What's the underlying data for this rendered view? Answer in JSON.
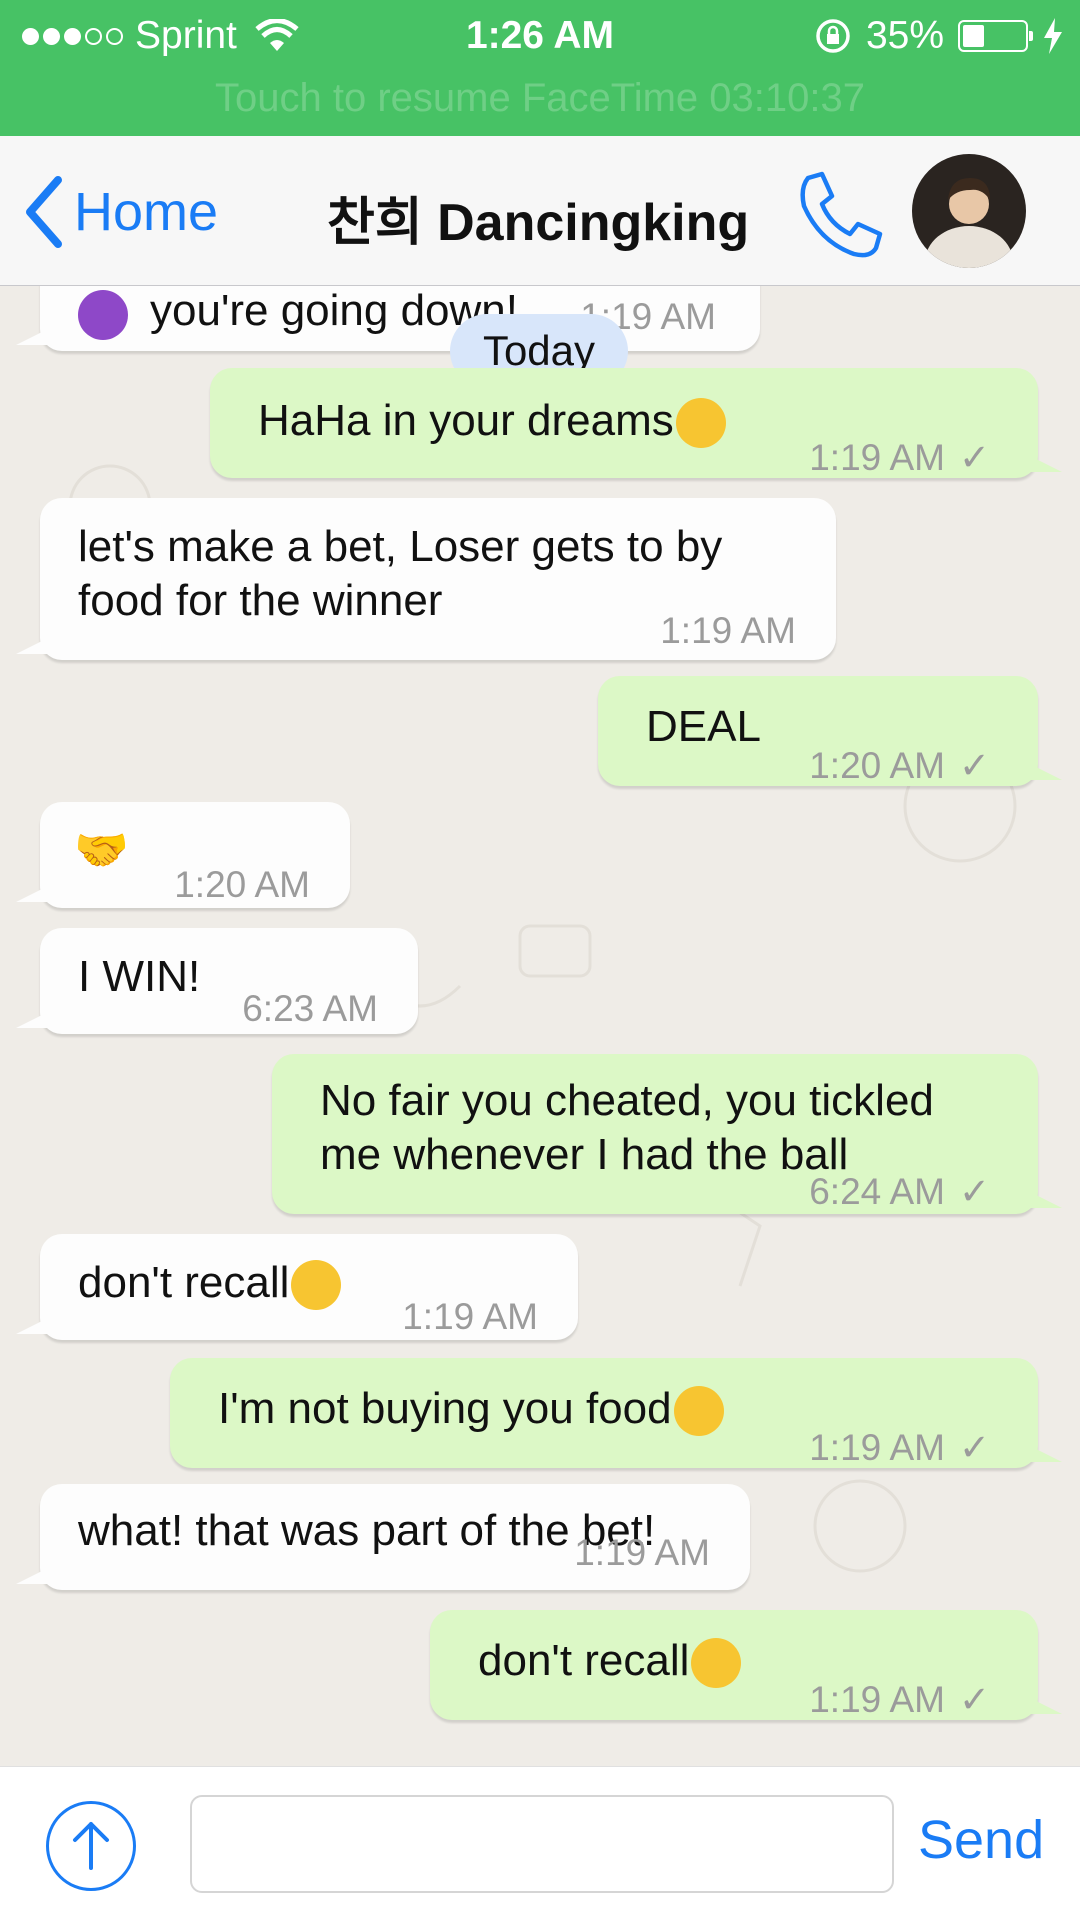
{
  "status_bar": {
    "carrier": "Sprint",
    "time": "1:26 AM",
    "battery": "35%",
    "battery_level": 0.35,
    "facetime_banner": "Touch to resume FaceTime 03:10:37"
  },
  "nav": {
    "back_label": "Home",
    "title": "찬희 Dancingking"
  },
  "chat": {
    "date_separator": "Today",
    "messages": [
      {
        "dir": "in",
        "text": "you're going down!",
        "time": "1:19 AM",
        "emoji_lead": "smiling-devil-emoji"
      },
      {
        "dir": "out",
        "text": "HaHa in your dreams",
        "time": "1:19 AM",
        "emoji": "tears-of-joy-emoji"
      },
      {
        "dir": "in",
        "text_line1": "let's make a bet, Loser gets to by",
        "text_line2": "food for the winner",
        "time": "1:19 AM"
      },
      {
        "dir": "out",
        "text": "DEAL",
        "time": "1:20 AM"
      },
      {
        "dir": "in",
        "text": "",
        "time": "1:20 AM",
        "emoji": "handshake-emoji"
      },
      {
        "dir": "in",
        "text": "I WIN!",
        "time": "6:23 AM"
      },
      {
        "dir": "out",
        "text_line1": "No fair you cheated, you tickled",
        "text_line2": "me whenever I had the ball",
        "time": "6:24 AM"
      },
      {
        "dir": "in",
        "text": "don't recall",
        "time": "1:19 AM",
        "emoji": "face-savoring-food-emoji"
      },
      {
        "dir": "out",
        "text": "I'm not buying you food",
        "time": "1:19 AM",
        "emoji": "unamused-face-emoji"
      },
      {
        "dir": "in",
        "text": "what! that was part of the bet!",
        "time": "1:19 AM"
      },
      {
        "dir": "out",
        "text": "don't recall",
        "time": "1:19 AM",
        "emoji": "smiling-face-emoji"
      }
    ]
  },
  "input_bar": {
    "placeholder": "",
    "send_label": "Send"
  },
  "colors": {
    "status_green": "#47c265",
    "accent_blue": "#1a7cf5",
    "outgoing_bubble": "#dcf8c6",
    "incoming_bubble": "#fdfdfd"
  }
}
